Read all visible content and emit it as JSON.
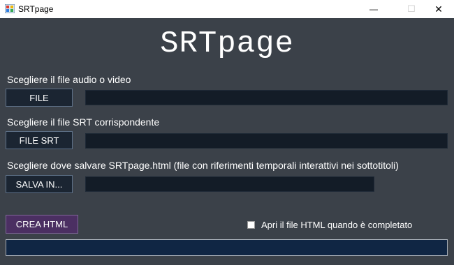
{
  "window": {
    "title": "SRTpage",
    "minimize_glyph": "—",
    "maximize_glyph": "☐",
    "close_glyph": "✕"
  },
  "main": {
    "heading": "SRTpage",
    "audio_label": "Scegliere il file audio o video",
    "audio_button": "FILE",
    "audio_path": "",
    "srt_label": "Scegliere il file SRT corrispondente",
    "srt_button": "FILE SRT",
    "srt_path": "",
    "save_label": "Scegliere dove salvare SRTpage.html (file con riferimenti temporali interattivi nei sottotitoli)",
    "save_button": "SALVA IN...",
    "save_path": "",
    "create_button": "CREA HTML",
    "open_checkbox_label": "Apri il file HTML quando è completato",
    "open_checkbox_checked": false,
    "progress": 0
  },
  "colors": {
    "background": "#3b4149",
    "field": "#131c27",
    "button": "#1b2532",
    "create_button": "#4b2f62",
    "progress_bar": "#102644"
  }
}
